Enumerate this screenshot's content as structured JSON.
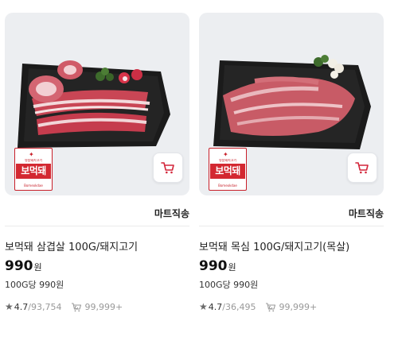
{
  "products": [
    {
      "badge": {
        "small": "명품돼지고기",
        "logo": "보먹돼",
        "sub": "Bomeokdae"
      },
      "seller": "마트직송",
      "title": "보먹돼 삼겹살 100G/돼지고기",
      "price": "990",
      "currency": "원",
      "unit_price": "100G당 990원",
      "rating": "4.7",
      "review_count": "93,754",
      "rebuy_count": "99,999+"
    },
    {
      "badge": {
        "small": "명품돼지고기",
        "logo": "보먹돼",
        "sub": "Bomeokdae"
      },
      "seller": "마트직송",
      "title": "보먹돼 목심 100G/돼지고기(목살)",
      "price": "990",
      "currency": "원",
      "unit_price": "100G당 990원",
      "rating": "4.7",
      "review_count": "36,495",
      "rebuy_count": "99,999+"
    }
  ],
  "colors": {
    "brand_red": "#d32831",
    "cart_icon": "#d3273b",
    "text": "#222222",
    "muted": "#999999"
  },
  "icons": {
    "star": "★",
    "cart": "cart-icon",
    "rebuy": "rebuy-icon"
  }
}
